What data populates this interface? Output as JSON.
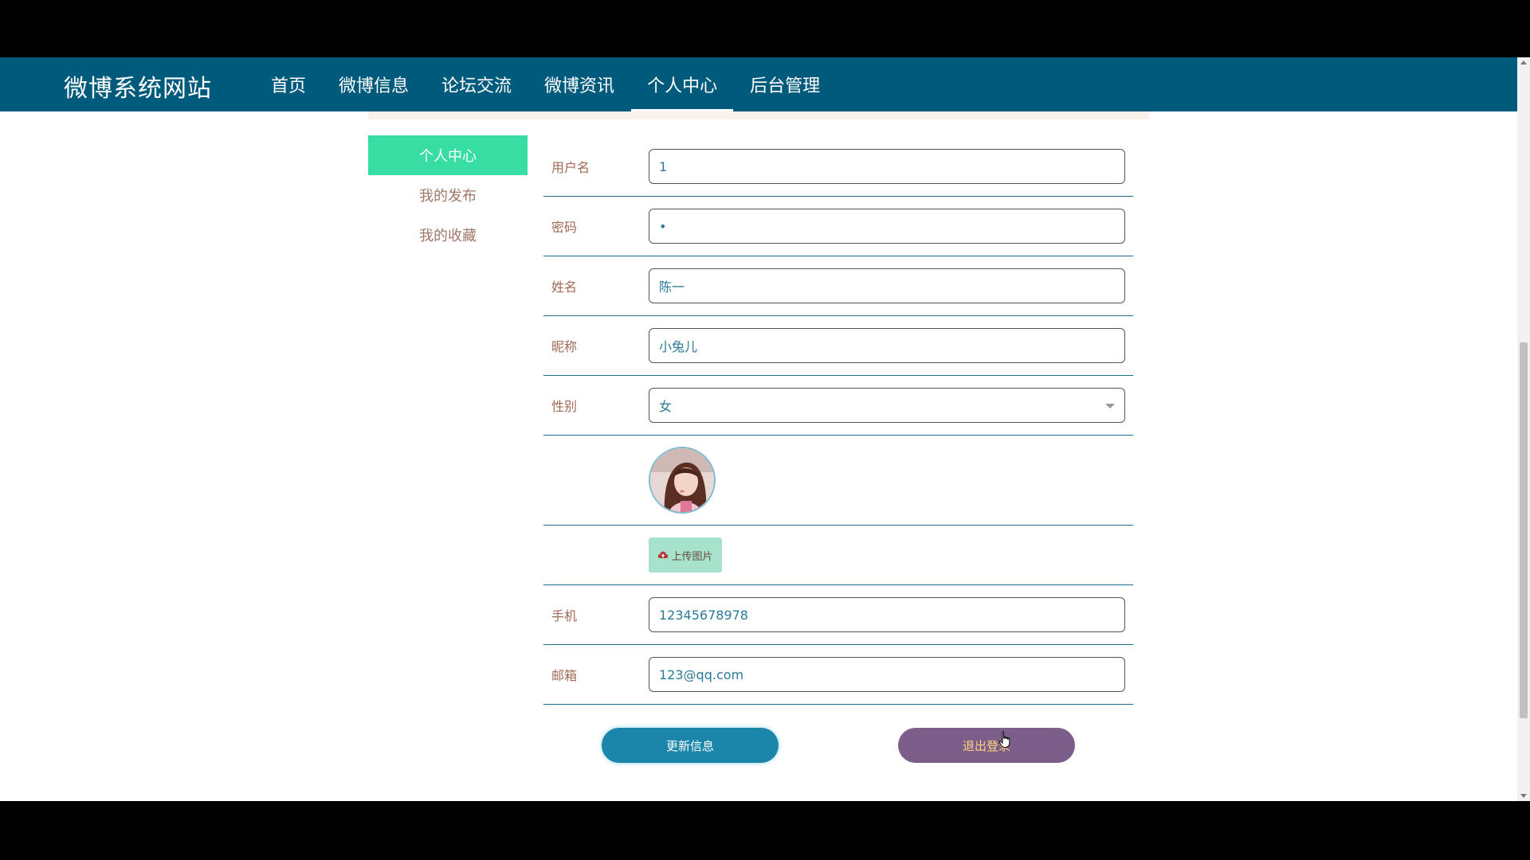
{
  "navbar": {
    "brand": "微博系统网站",
    "items": [
      {
        "label": "首页",
        "active": false
      },
      {
        "label": "微博信息",
        "active": false
      },
      {
        "label": "论坛交流",
        "active": false
      },
      {
        "label": "微博资讯",
        "active": false
      },
      {
        "label": "个人中心",
        "active": true
      },
      {
        "label": "后台管理",
        "active": false
      }
    ]
  },
  "sidebar": {
    "items": [
      {
        "label": "个人中心",
        "active": true
      },
      {
        "label": "我的发布",
        "active": false
      },
      {
        "label": "我的收藏",
        "active": false
      }
    ]
  },
  "form": {
    "username": {
      "label": "用户名",
      "value": "1"
    },
    "password": {
      "label": "密码",
      "value": "•"
    },
    "name": {
      "label": "姓名",
      "value": "陈一"
    },
    "nickname": {
      "label": "昵称",
      "value": "小兔儿"
    },
    "gender": {
      "label": "性别",
      "value": "女"
    },
    "upload": {
      "label": "上传图片"
    },
    "phone": {
      "label": "手机",
      "value": "12345678978"
    },
    "email": {
      "label": "邮箱",
      "value": "123@qq.com"
    }
  },
  "actions": {
    "update_label": "更新信息",
    "logout_label": "退出登录"
  },
  "colors": {
    "navbar": "#005a7c",
    "sidebar_active": "#37dda2",
    "update_button": "#1b86aa",
    "logout_button": "#7d5e8a"
  }
}
